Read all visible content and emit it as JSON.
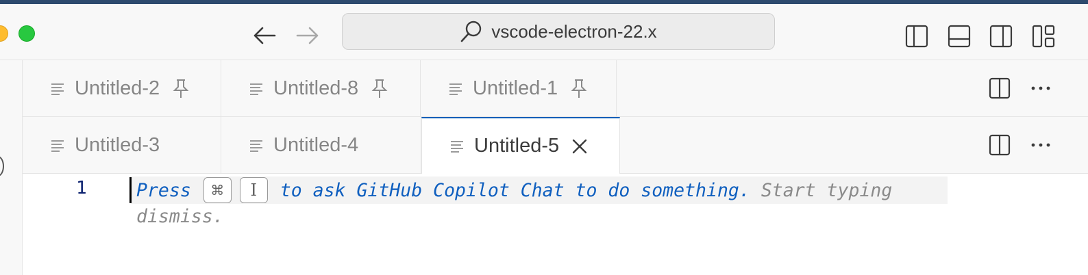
{
  "window": {
    "search_text": "vscode-electron-22.x",
    "icons": {
      "back": "arrow-left-icon",
      "forward": "arrow-right-icon",
      "search": "search-icon",
      "layout": [
        "toggle-primary-sidebar-icon",
        "toggle-panel-icon",
        "toggle-secondary-sidebar-icon",
        "customize-layout-icon"
      ]
    }
  },
  "editor_groups": [
    {
      "tabs": [
        {
          "label": "Untitled-2",
          "pinned": true,
          "active": false
        },
        {
          "label": "Untitled-8",
          "pinned": true,
          "active": false
        },
        {
          "label": "Untitled-1",
          "pinned": true,
          "active": false
        }
      ]
    },
    {
      "tabs": [
        {
          "label": "Untitled-3",
          "pinned": false,
          "active": false
        },
        {
          "label": "Untitled-4",
          "pinned": false,
          "active": false
        },
        {
          "label": "Untitled-5",
          "pinned": false,
          "active": true
        }
      ]
    }
  ],
  "editor": {
    "line_number": "1",
    "hint": {
      "press": "Press",
      "key1": "⌘",
      "key2": "I",
      "blue_text": "to ask GitHub Copilot Chat to do something.",
      "gray_text": "Start typing",
      "wrap_text": "dismiss."
    }
  },
  "colors": {
    "accent": "#005fb8",
    "hint_blue": "#0f5fbf",
    "hint_gray": "#8a8a8a",
    "line_number": "#0b216f"
  }
}
